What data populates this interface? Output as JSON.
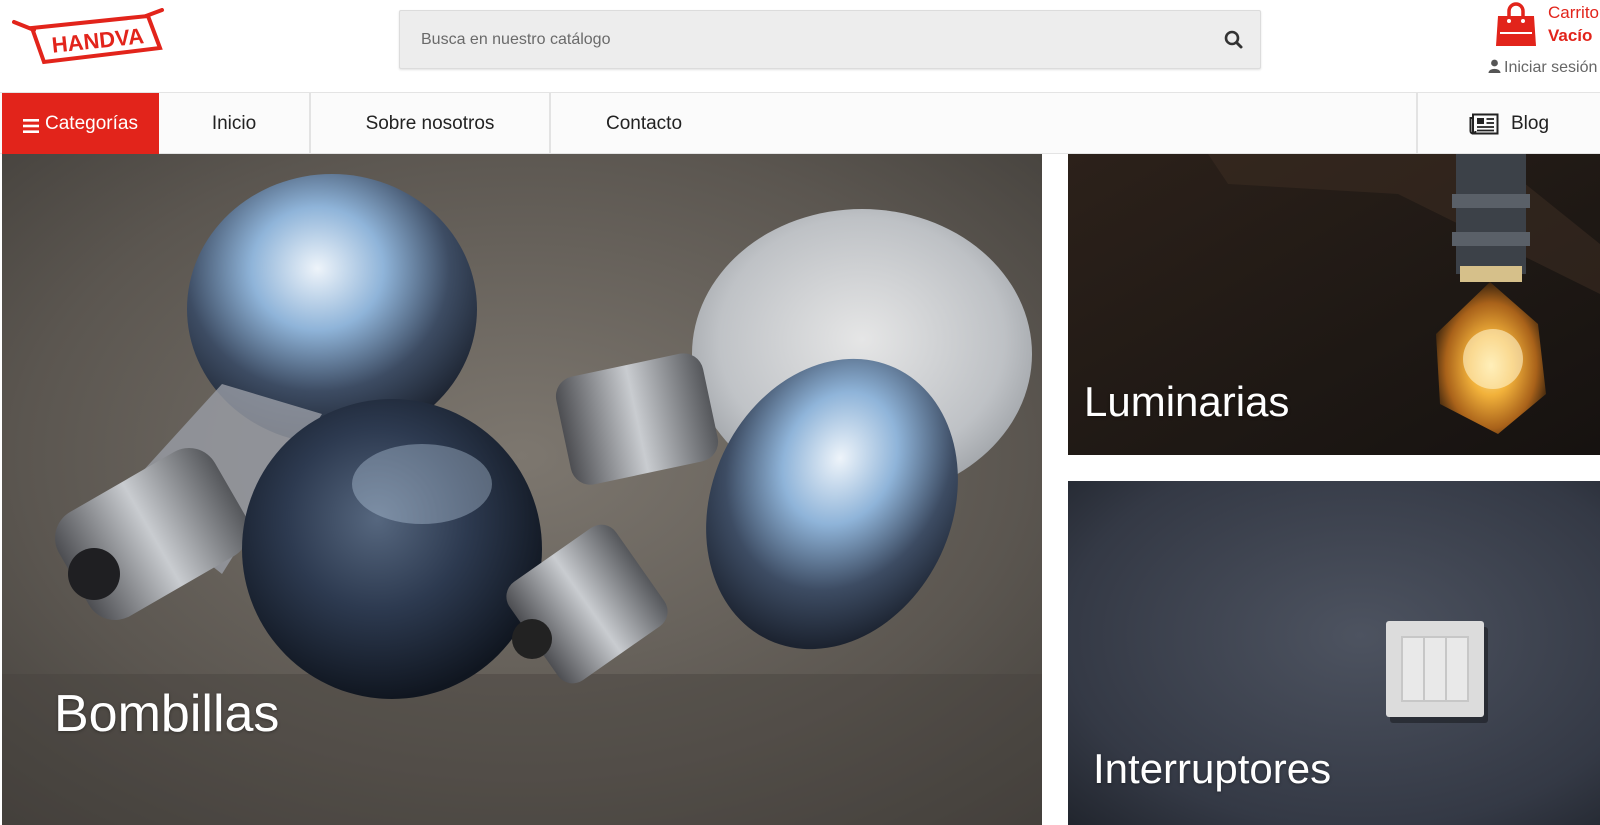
{
  "brand": {
    "logo_text": "HANDVA",
    "accent_color": "#e2241b"
  },
  "search": {
    "placeholder": "Busca en nuestro catálogo",
    "value": "",
    "icon": "search-icon"
  },
  "cart": {
    "title": "Carrito",
    "status": "Vacío",
    "icon": "shopping-bag-icon"
  },
  "account": {
    "login_label": "Iniciar sesión",
    "icon": "user-icon"
  },
  "nav": {
    "categories_label": "Categorías",
    "categories_icon": "menu-icon",
    "items": [
      {
        "label": "Inicio"
      },
      {
        "label": "Sobre nosotros"
      },
      {
        "label": "Contacto"
      }
    ],
    "blog_label": "Blog",
    "blog_icon": "newspaper-icon"
  },
  "tiles": {
    "bombillas": {
      "label": "Bombillas"
    },
    "luminarias": {
      "label": "Luminarias"
    },
    "interruptores": {
      "label": "Interruptores"
    }
  }
}
